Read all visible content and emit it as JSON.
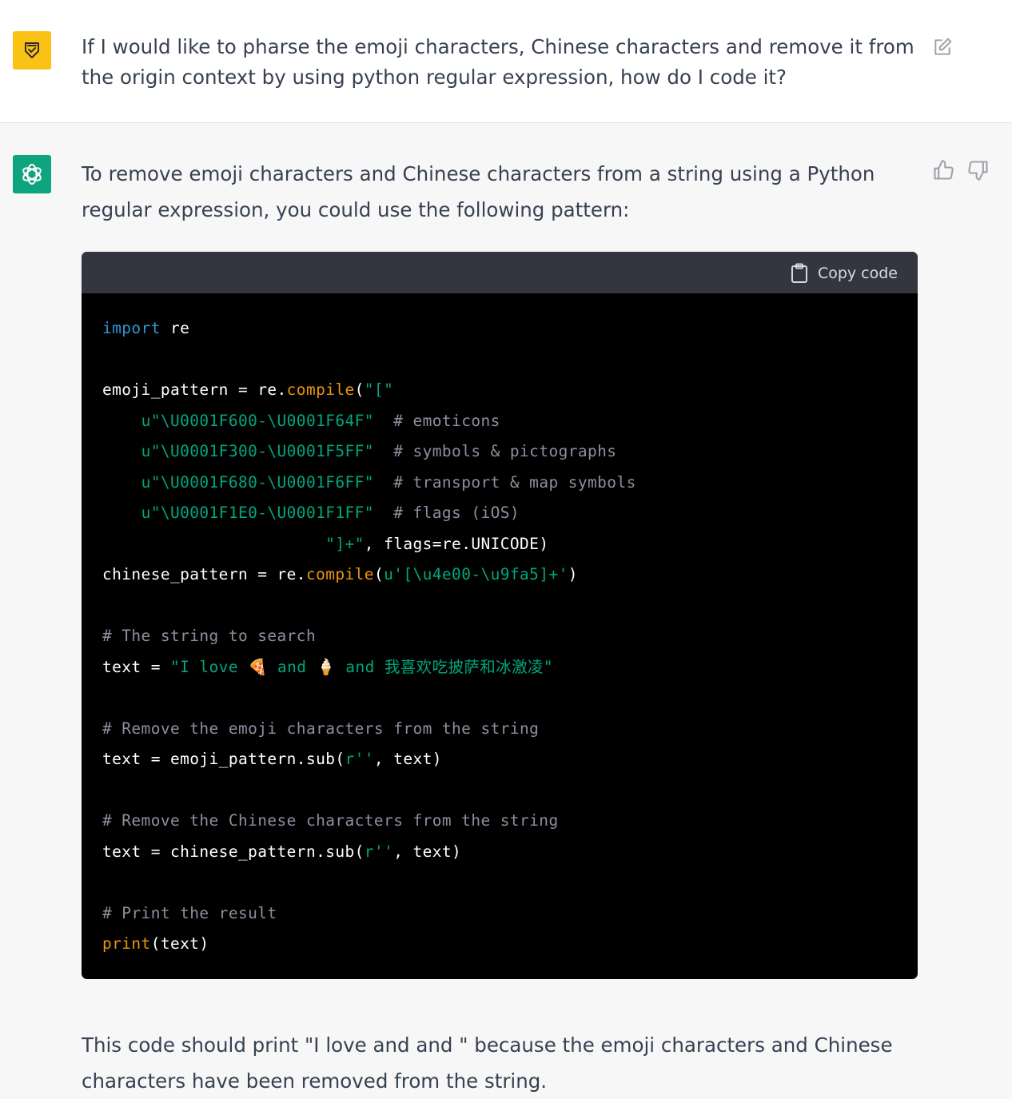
{
  "user": {
    "message": "If I would like to pharse the emoji characters, Chinese characters and remove it from the origin context by using python regular expression, how do I code it?"
  },
  "assistant": {
    "intro": "To remove emoji characters and Chinese characters from a string using a Python regular expression, you could use the following pattern:",
    "copy_label": "Copy code",
    "outro": "This code should print \"I love and and \" because the emoji characters and Chinese characters have been removed from the string."
  },
  "code": {
    "l1": [
      "import",
      " re"
    ],
    "l3": [
      "emoji_pattern = re.",
      "compile",
      "(",
      "\"[\""
    ],
    "l4": [
      "    ",
      "u\"\\U0001F600-\\U0001F64F\"",
      "  ",
      "# emoticons"
    ],
    "l5": [
      "    ",
      "u\"\\U0001F300-\\U0001F5FF\"",
      "  ",
      "# symbols & pictographs"
    ],
    "l6": [
      "    ",
      "u\"\\U0001F680-\\U0001F6FF\"",
      "  ",
      "# transport & map symbols"
    ],
    "l7": [
      "    ",
      "u\"\\U0001F1E0-\\U0001F1FF\"",
      "  ",
      "# flags (iOS)"
    ],
    "l8": [
      "                       ",
      "\"]+\"",
      ", flags=re.UNICODE)"
    ],
    "l9": [
      "chinese_pattern = re.",
      "compile",
      "(",
      "u'[\\u4e00-\\u9fa5]+'",
      ")"
    ],
    "l11": [
      "# The string to search"
    ],
    "l12": [
      "text = ",
      "\"I love 🍕 and 🍦 and 我喜欢吃披萨和冰激凌\""
    ],
    "l14": [
      "# Remove the emoji characters from the string"
    ],
    "l15": [
      "text = emoji_pattern.sub(",
      "r''",
      ", text)"
    ],
    "l17": [
      "# Remove the Chinese characters from the string"
    ],
    "l18": [
      "text = chinese_pattern.sub(",
      "r''",
      ", text)"
    ],
    "l20": [
      "# Print the result"
    ],
    "l21": [
      "print",
      "(text)"
    ]
  },
  "colors": {
    "user_avatar": "#fbc216",
    "bot_avatar": "#10a37f",
    "keyword": "#2e95d3",
    "function": "#e9950c",
    "string": "#00a67d",
    "comment": "#8e8ea0"
  },
  "icons": {
    "user_avatar": "user-avatar-icon",
    "bot_avatar": "openai-logo-icon",
    "edit": "edit-icon",
    "copy": "clipboard-icon",
    "like": "thumbs-up-icon",
    "dislike": "thumbs-down-icon"
  }
}
